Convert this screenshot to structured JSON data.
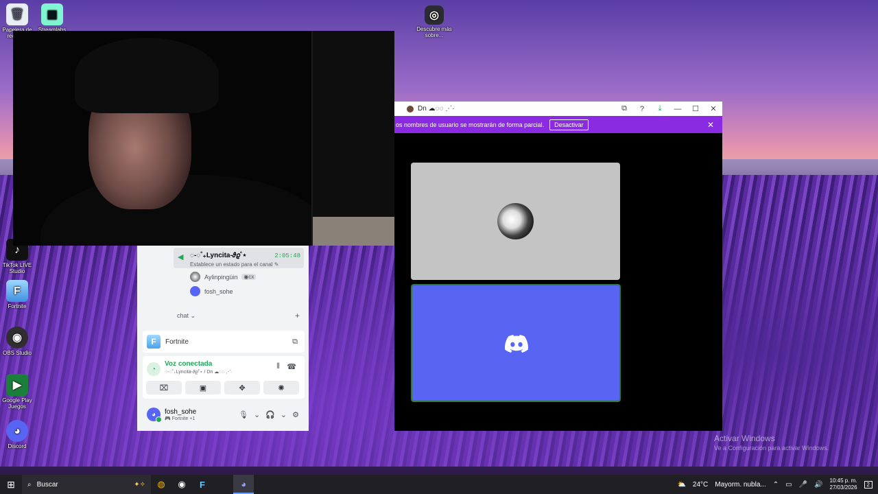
{
  "desktop": {
    "icons": [
      {
        "label": "Papelera de reciclaje",
        "glyph": "🗑"
      },
      {
        "label": "Streamlabs",
        "glyph": "▣"
      },
      {
        "label": "Descubre más sobre...",
        "glyph": "◎"
      },
      {
        "label": "TikTok LIVE Studio",
        "glyph": "♪"
      },
      {
        "label": "Fortnite",
        "glyph": "F"
      },
      {
        "label": "OBS Studio",
        "glyph": "◉"
      },
      {
        "label": "Google Play Juegos",
        "glyph": "▶"
      },
      {
        "label": "Discord",
        "glyph": "◕"
      }
    ],
    "watermark_title": "Activar Windows",
    "watermark_sub": "Ve a Configuración para activar Windows."
  },
  "discord_popout": {
    "title": "Dn ☁◌◌ ⋰·",
    "notice_text": "os nombres de usuario se mostrarán de forma parcial.",
    "notice_button": "Desactivar",
    "notice_close": "✕",
    "controls": [
      "⧉",
      "?",
      "⤓",
      "—",
      "☐",
      "✕"
    ]
  },
  "discord_sidebar": {
    "voice_channel_name": "◌-◌˚₊Lyncita-𝜗𝜚˚⋆",
    "voice_channel_status": "Establece un estado para el canal ✎",
    "voice_channel_timer": "2:05:48",
    "members": [
      {
        "name": "Aylinpingüin",
        "badge": "◉cx"
      },
      {
        "name": "fosh_sohe",
        "badge": ""
      }
    ],
    "chat_category": "chat ⌄",
    "game_name": "Fortnite",
    "voice_status": "Voz conectada",
    "voice_location": "◌-◌˚₊Lyncita-𝜗𝜚˚⋆ / Dn ☁◌◌ ⋰·",
    "buttons": [
      "⌧",
      "▣",
      "✥",
      "✺"
    ],
    "user_name": "fosh_sohe",
    "user_activity": "🎮 Fortnite +1"
  },
  "taskbar": {
    "search_placeholder": "Buscar",
    "weather_temp": "24°C",
    "weather_text": "Mayorm. nubla...",
    "time": "10:45 p. m.",
    "date": "27/03/2026",
    "notifications": "2"
  },
  "colors": {
    "discord_blurple": "#5865f2",
    "notice_purple": "#8a2be2",
    "voice_green": "#23a55a"
  }
}
